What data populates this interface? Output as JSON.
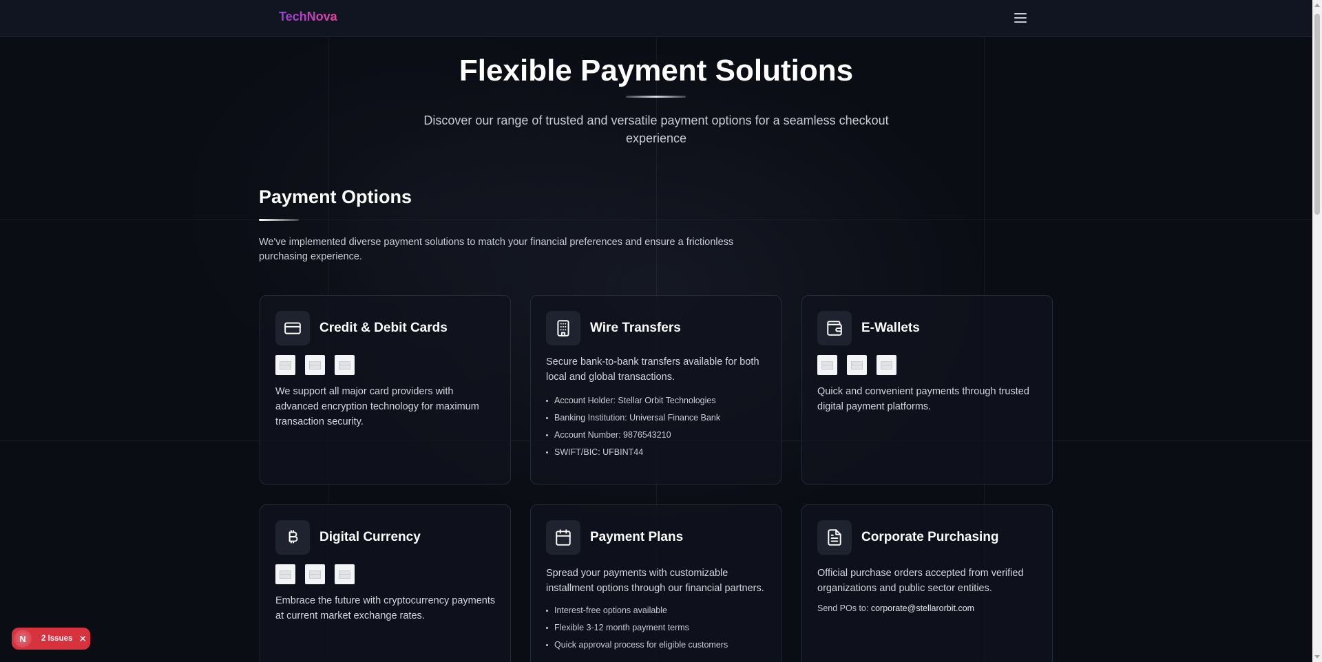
{
  "navbar": {
    "brand": "TechNova",
    "menu_icon": "hamburger-menu-icon"
  },
  "hero": {
    "title": "Flexible Payment Solutions",
    "subtitle": "Discover our range of trusted and versatile payment options for a seamless checkout experience"
  },
  "section": {
    "title": "Payment Options",
    "description": "We've implemented diverse payment solutions to match your financial preferences and ensure a frictionless purchasing experience."
  },
  "cards": [
    {
      "icon": "credit-card-icon",
      "title": "Credit & Debit Cards",
      "description": "We support all major card providers with advanced encryption technology for maximum transaction security."
    },
    {
      "icon": "building-icon",
      "title": "Wire Transfers",
      "description": "Secure bank-to-bank transfers available for both local and global transactions.",
      "details": [
        "Account Holder: Stellar Orbit Technologies",
        "Banking Institution: Universal Finance Bank",
        "Account Number: 9876543210",
        "SWIFT/BIC: UFBINT44"
      ]
    },
    {
      "icon": "wallet-icon",
      "title": "E-Wallets",
      "description": "Quick and convenient payments through trusted digital payment platforms."
    },
    {
      "icon": "bitcoin-icon",
      "title": "Digital Currency",
      "description": "Embrace the future with cryptocurrency payments at current market exchange rates."
    },
    {
      "icon": "calendar-icon",
      "title": "Payment Plans",
      "description": "Spread your payments with customizable installment options through our financial partners.",
      "details": [
        "Interest-free options available",
        "Flexible 3-12 month payment terms",
        "Quick approval process for eligible customers"
      ]
    },
    {
      "icon": "document-icon",
      "title": "Corporate Purchasing",
      "description": "Official purchase orders accepted from verified organizations and public sector entities.",
      "note_prefix": "Send POs to: ",
      "note_email": "corporate@stellarorbit.com"
    }
  ],
  "issues_badge": {
    "logo_letter": "N",
    "label": "2 Issues",
    "close": "✕"
  },
  "colors": {
    "background": "#0b0d15",
    "navbar": "#111521",
    "brand_start": "#9a3ee0",
    "brand_end": "#e0469a",
    "issues_badge": "#d6333f"
  }
}
